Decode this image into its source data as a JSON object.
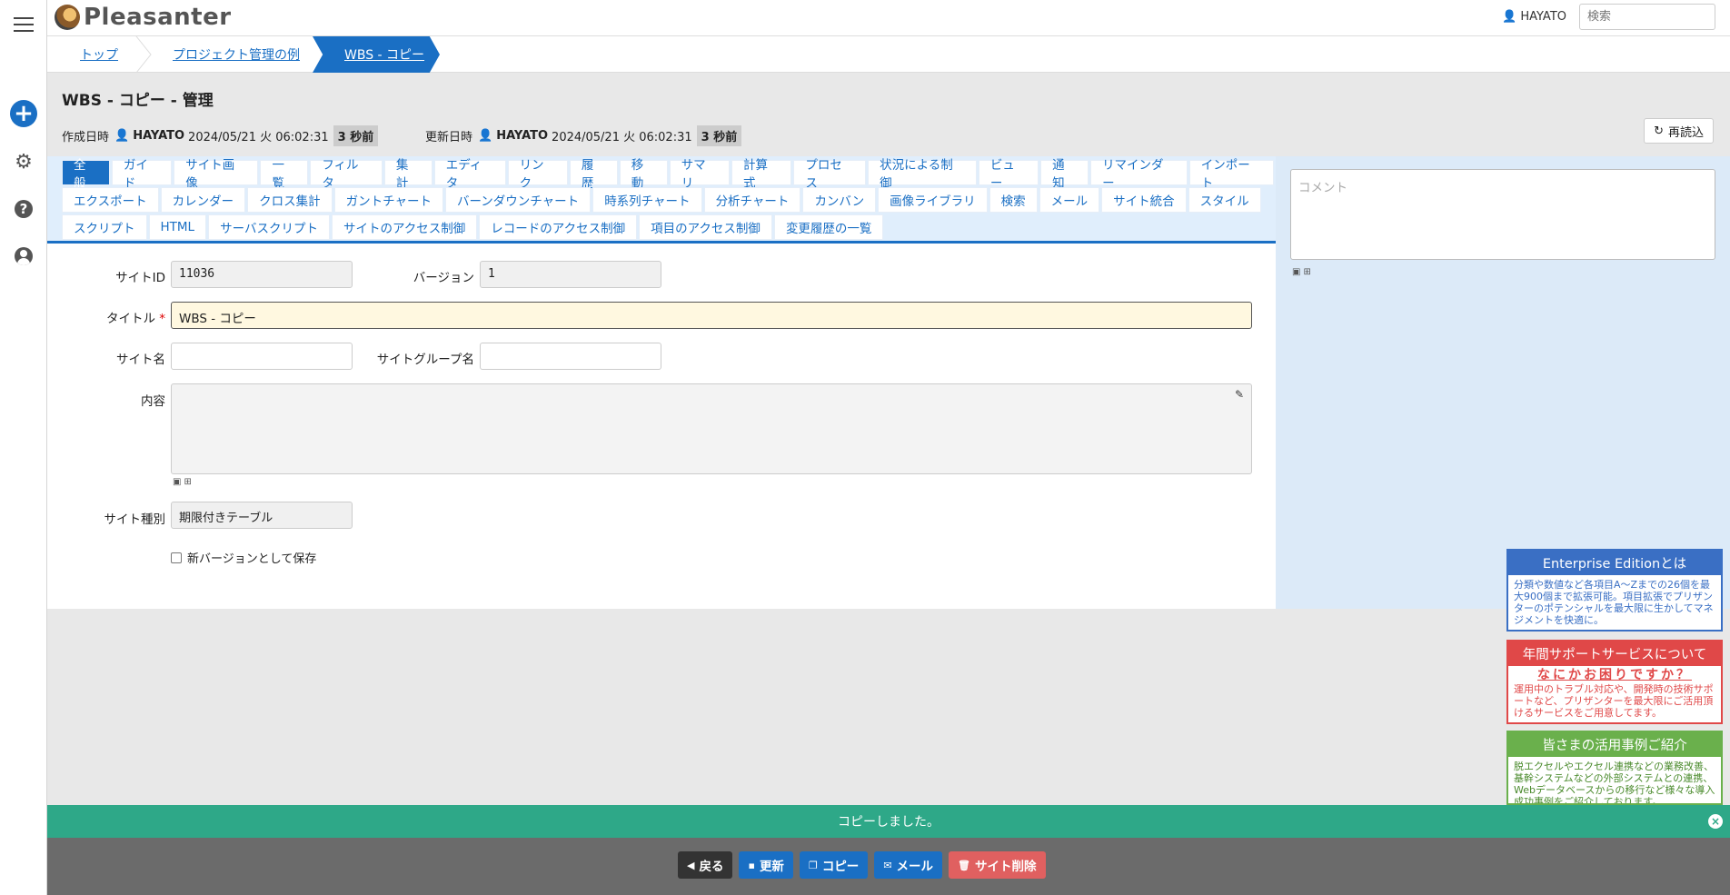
{
  "app": {
    "logo_text": "Pleasanter"
  },
  "header": {
    "user": "HAYATO",
    "search_placeholder": "検索"
  },
  "breadcrumb": {
    "items": [
      "トップ",
      "プロジェクト管理の例"
    ],
    "current": "WBS - コピー"
  },
  "page": {
    "title": "WBS - コピー - 管理",
    "created_label": "作成日時",
    "created_user": "HAYATO",
    "created_at": "2024/05/21 火 06:02:31",
    "created_ago": "3 秒前",
    "updated_label": "更新日時",
    "updated_user": "HAYATO",
    "updated_at": "2024/05/21 火 06:02:31",
    "updated_ago": "3 秒前",
    "reload_label": "再読込"
  },
  "tabs": {
    "row1": [
      "全般",
      "ガイド",
      "サイト画像",
      "一覧",
      "フィルタ",
      "集計",
      "エディタ",
      "リンク",
      "履歴",
      "移動",
      "サマリ",
      "計算式",
      "プロセス",
      "状況による制御",
      "ビュー",
      "通知",
      "リマインダー",
      "インポート"
    ],
    "row2": [
      "エクスポート",
      "カレンダー",
      "クロス集計",
      "ガントチャート",
      "バーンダウンチャート",
      "時系列チャート",
      "分析チャート",
      "カンバン",
      "画像ライブラリ",
      "検索",
      "メール",
      "サイト統合",
      "スタイル"
    ],
    "row3": [
      "スクリプト",
      "HTML",
      "サーバスクリプト",
      "サイトのアクセス制御",
      "レコードのアクセス制御",
      "項目のアクセス制御",
      "変更履歴の一覧"
    ]
  },
  "form": {
    "site_id_label": "サイトID",
    "site_id": "11036",
    "version_label": "バージョン",
    "version": "1",
    "title_label": "タイトル",
    "title_value": "WBS - コピー",
    "site_name_label": "サイト名",
    "site_group_label": "サイトグループ名",
    "content_label": "内容",
    "site_type_label": "サイト種別",
    "site_type": "期限付きテーブル",
    "new_version_label": "新バージョンとして保存"
  },
  "comment": {
    "placeholder": "コメント"
  },
  "ads": {
    "enterprise": {
      "title": "Enterprise Editionとは",
      "body": "分類や数値など各項目A～Zまでの26個を最大900個まで拡張可能。項目拡張でプリザンターのポテンシャルを最大限に生かしてマネジメントを快適に。"
    },
    "support": {
      "title": "年間サポートサービスについて",
      "sub": "なにかお困りですか？",
      "body": "運用中のトラブル対応や、開発時の技術サポートなど、プリザンターを最大限にご活用頂けるサービスをご用意してます。"
    },
    "cases": {
      "title": "皆さまの活用事例ご紹介",
      "body": "脱エクセルやエクセル連携などの業務改善、基幹システムなどの外部システムとの連携、Webデータベースからの移行など様々な導入成功事例をご紹介しております。"
    }
  },
  "toast": {
    "message": "コピーしました。"
  },
  "footer": {
    "back": "戻る",
    "update": "更新",
    "copy": "コピー",
    "mail": "メール",
    "delete": "サイト削除"
  },
  "colors": {
    "accent": "#1a6fc4",
    "toast": "#2ea888",
    "danger": "#e06060"
  }
}
